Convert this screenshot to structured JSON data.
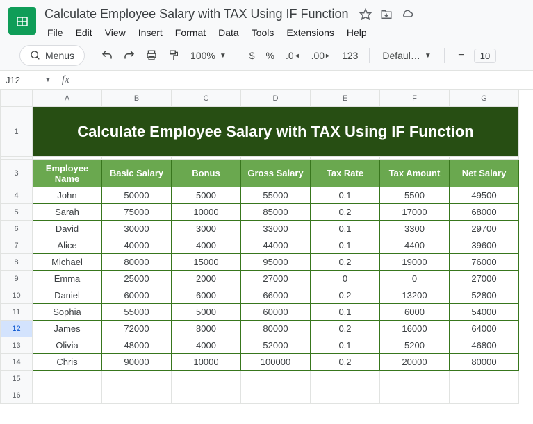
{
  "document": {
    "title": "Calculate Employee Salary with TAX Using IF Function"
  },
  "menus": {
    "file": "File",
    "edit": "Edit",
    "view": "View",
    "insert": "Insert",
    "format": "Format",
    "data": "Data",
    "tools": "Tools",
    "extensions": "Extensions",
    "help": "Help"
  },
  "toolbar": {
    "menus_label": "Menus",
    "zoom": "100%",
    "currency": "$",
    "percent": "%",
    "decrease_dec": ".0",
    "increase_dec": ".00",
    "numfmt": "123",
    "font": "Defaul…",
    "font_size": "10"
  },
  "namebox": "J12",
  "formula": "",
  "columns": [
    "A",
    "B",
    "C",
    "D",
    "E",
    "F",
    "G"
  ],
  "sheet_title": "Calculate Employee Salary with TAX Using IF Function",
  "chart_data": {
    "type": "table",
    "headers": [
      "Employee Name",
      "Basic Salary",
      "Bonus",
      "Gross Salary",
      "Tax Rate",
      "Tax Amount",
      "Net Salary"
    ],
    "rows": [
      [
        "John",
        "50000",
        "5000",
        "55000",
        "0.1",
        "5500",
        "49500"
      ],
      [
        "Sarah",
        "75000",
        "10000",
        "85000",
        "0.2",
        "17000",
        "68000"
      ],
      [
        "David",
        "30000",
        "3000",
        "33000",
        "0.1",
        "3300",
        "29700"
      ],
      [
        "Alice",
        "40000",
        "4000",
        "44000",
        "0.1",
        "4400",
        "39600"
      ],
      [
        "Michael",
        "80000",
        "15000",
        "95000",
        "0.2",
        "19000",
        "76000"
      ],
      [
        "Emma",
        "25000",
        "2000",
        "27000",
        "0",
        "0",
        "27000"
      ],
      [
        "Daniel",
        "60000",
        "6000",
        "66000",
        "0.2",
        "13200",
        "52800"
      ],
      [
        "Sophia",
        "55000",
        "5000",
        "60000",
        "0.1",
        "6000",
        "54000"
      ],
      [
        "James",
        "72000",
        "8000",
        "80000",
        "0.2",
        "16000",
        "64000"
      ],
      [
        "Olivia",
        "48000",
        "4000",
        "52000",
        "0.1",
        "5200",
        "46800"
      ],
      [
        "Chris",
        "90000",
        "10000",
        "100000",
        "0.2",
        "20000",
        "80000"
      ]
    ]
  },
  "selected_row": "12"
}
